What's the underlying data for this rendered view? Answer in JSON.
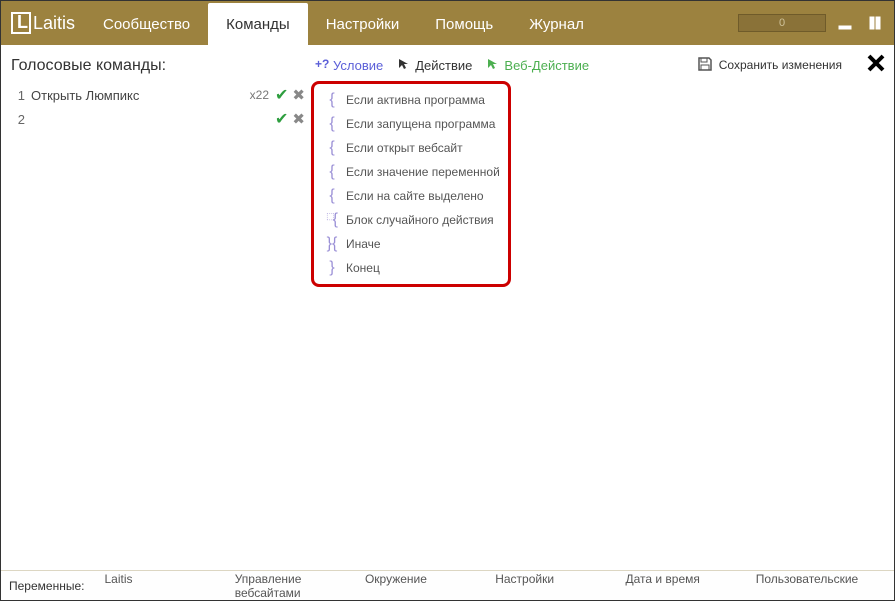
{
  "app": {
    "name": "Laitis",
    "progress_value": "0"
  },
  "tabs": {
    "community": "Сообщество",
    "commands": "Команды",
    "settings": "Настройки",
    "help": "Помощь",
    "journal": "Журнал"
  },
  "left": {
    "title": "Голосовые команды:",
    "rows": [
      {
        "idx": "1",
        "name": "Открыть Люмпикс",
        "count": "x22"
      },
      {
        "idx": "2",
        "name": "",
        "count": ""
      }
    ]
  },
  "toolbar": {
    "condition": "Условие",
    "action": "Действие",
    "web_action": "Веб-Действие",
    "save": "Сохранить изменения"
  },
  "dropdown": {
    "items": [
      "Если активна программа",
      "Если запущена программа",
      "Если открыт вебсайт",
      "Если значение переменной",
      "Если на сайте выделено",
      "Блок случайного действия",
      "Иначе",
      "Конец"
    ]
  },
  "footer": {
    "label": "Переменные:",
    "items": [
      "Laitis",
      "Управление вебсайтами",
      "Окружение",
      "Настройки",
      "Дата и время",
      "Пользовательские"
    ]
  }
}
